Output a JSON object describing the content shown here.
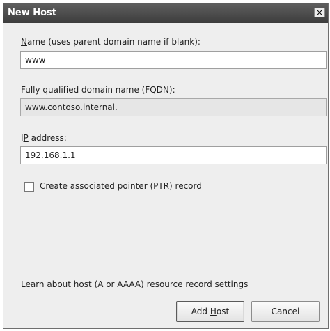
{
  "window": {
    "title": "New Host",
    "close_glyph": "×"
  },
  "name_field": {
    "label_accel": "N",
    "label_rest": "ame (uses parent domain name if blank):",
    "value": "www"
  },
  "fqdn_field": {
    "label": "Fully qualified domain name (FQDN):",
    "value": "www.contoso.internal."
  },
  "ip_field": {
    "label_first": "I",
    "label_accel": "P",
    "label_rest": " address:",
    "value": "192.168.1.1"
  },
  "ptr_checkbox": {
    "checked": false,
    "label_accel": "C",
    "label_rest": "reate associated pointer (PTR) record"
  },
  "help_link": {
    "text": "Learn about host (A or AAAA) resource record settings"
  },
  "buttons": {
    "add_host_prefix": "Add ",
    "add_host_accel": "H",
    "add_host_rest": "ost",
    "cancel": "Cancel"
  }
}
